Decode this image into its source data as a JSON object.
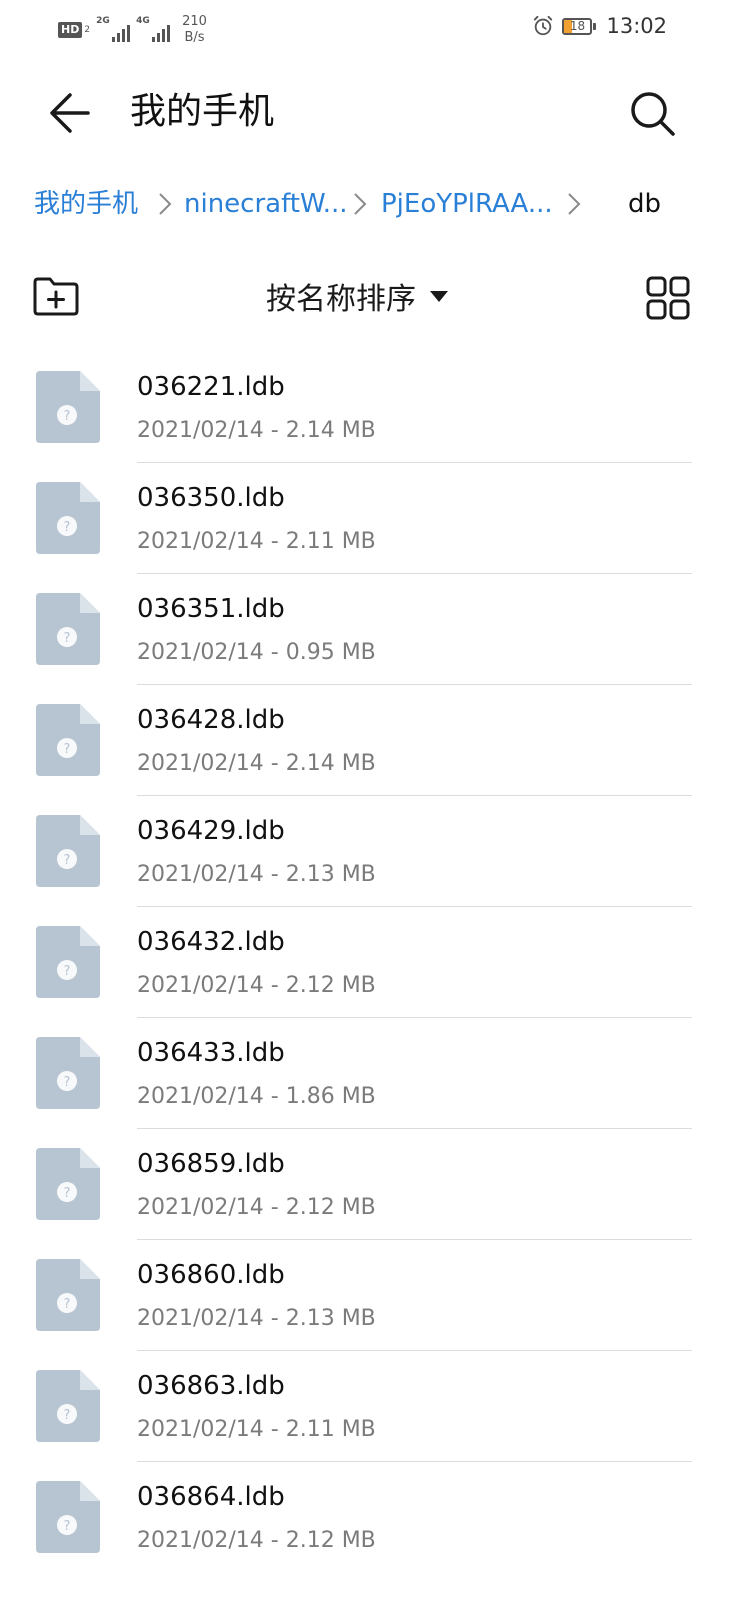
{
  "status_bar": {
    "hd_label": "HD",
    "hd_sub": "2",
    "signal1_tag": "2G",
    "signal2_tag": "4G",
    "net_speed_value": "210",
    "net_speed_unit": "B/s",
    "battery_level": "18",
    "time": "13:02"
  },
  "header": {
    "title": "我的手机"
  },
  "breadcrumb": {
    "items": [
      {
        "label": "我的手机"
      },
      {
        "label": "ninecraftW..."
      },
      {
        "label": "PjEoYPlRAA..."
      },
      {
        "label": "db"
      }
    ]
  },
  "toolbar": {
    "sort_label": "按名称排序"
  },
  "files": [
    {
      "name": "036221.ldb",
      "meta": "2021/02/14 - 2.14 MB"
    },
    {
      "name": "036350.ldb",
      "meta": "2021/02/14 - 2.11 MB"
    },
    {
      "name": "036351.ldb",
      "meta": "2021/02/14 - 0.95 MB"
    },
    {
      "name": "036428.ldb",
      "meta": "2021/02/14 - 2.14 MB"
    },
    {
      "name": "036429.ldb",
      "meta": "2021/02/14 - 2.13 MB"
    },
    {
      "name": "036432.ldb",
      "meta": "2021/02/14 - 2.12 MB"
    },
    {
      "name": "036433.ldb",
      "meta": "2021/02/14 - 1.86 MB"
    },
    {
      "name": "036859.ldb",
      "meta": "2021/02/14 - 2.12 MB"
    },
    {
      "name": "036860.ldb",
      "meta": "2021/02/14 - 2.13 MB"
    },
    {
      "name": "036863.ldb",
      "meta": "2021/02/14 - 2.11 MB"
    },
    {
      "name": "036864.ldb",
      "meta": "2021/02/14 - 2.12 MB"
    }
  ],
  "colors": {
    "accent": "#2a7fd6",
    "file_icon": "#b7c4d1",
    "battery_fill": "#f0a030"
  },
  "icons": {
    "back": "arrow-left-icon",
    "search": "search-icon",
    "new_folder": "folder-plus-icon",
    "grid_view": "grid-icon",
    "file": "unknown-file-icon",
    "alarm": "alarm-clock-icon"
  }
}
